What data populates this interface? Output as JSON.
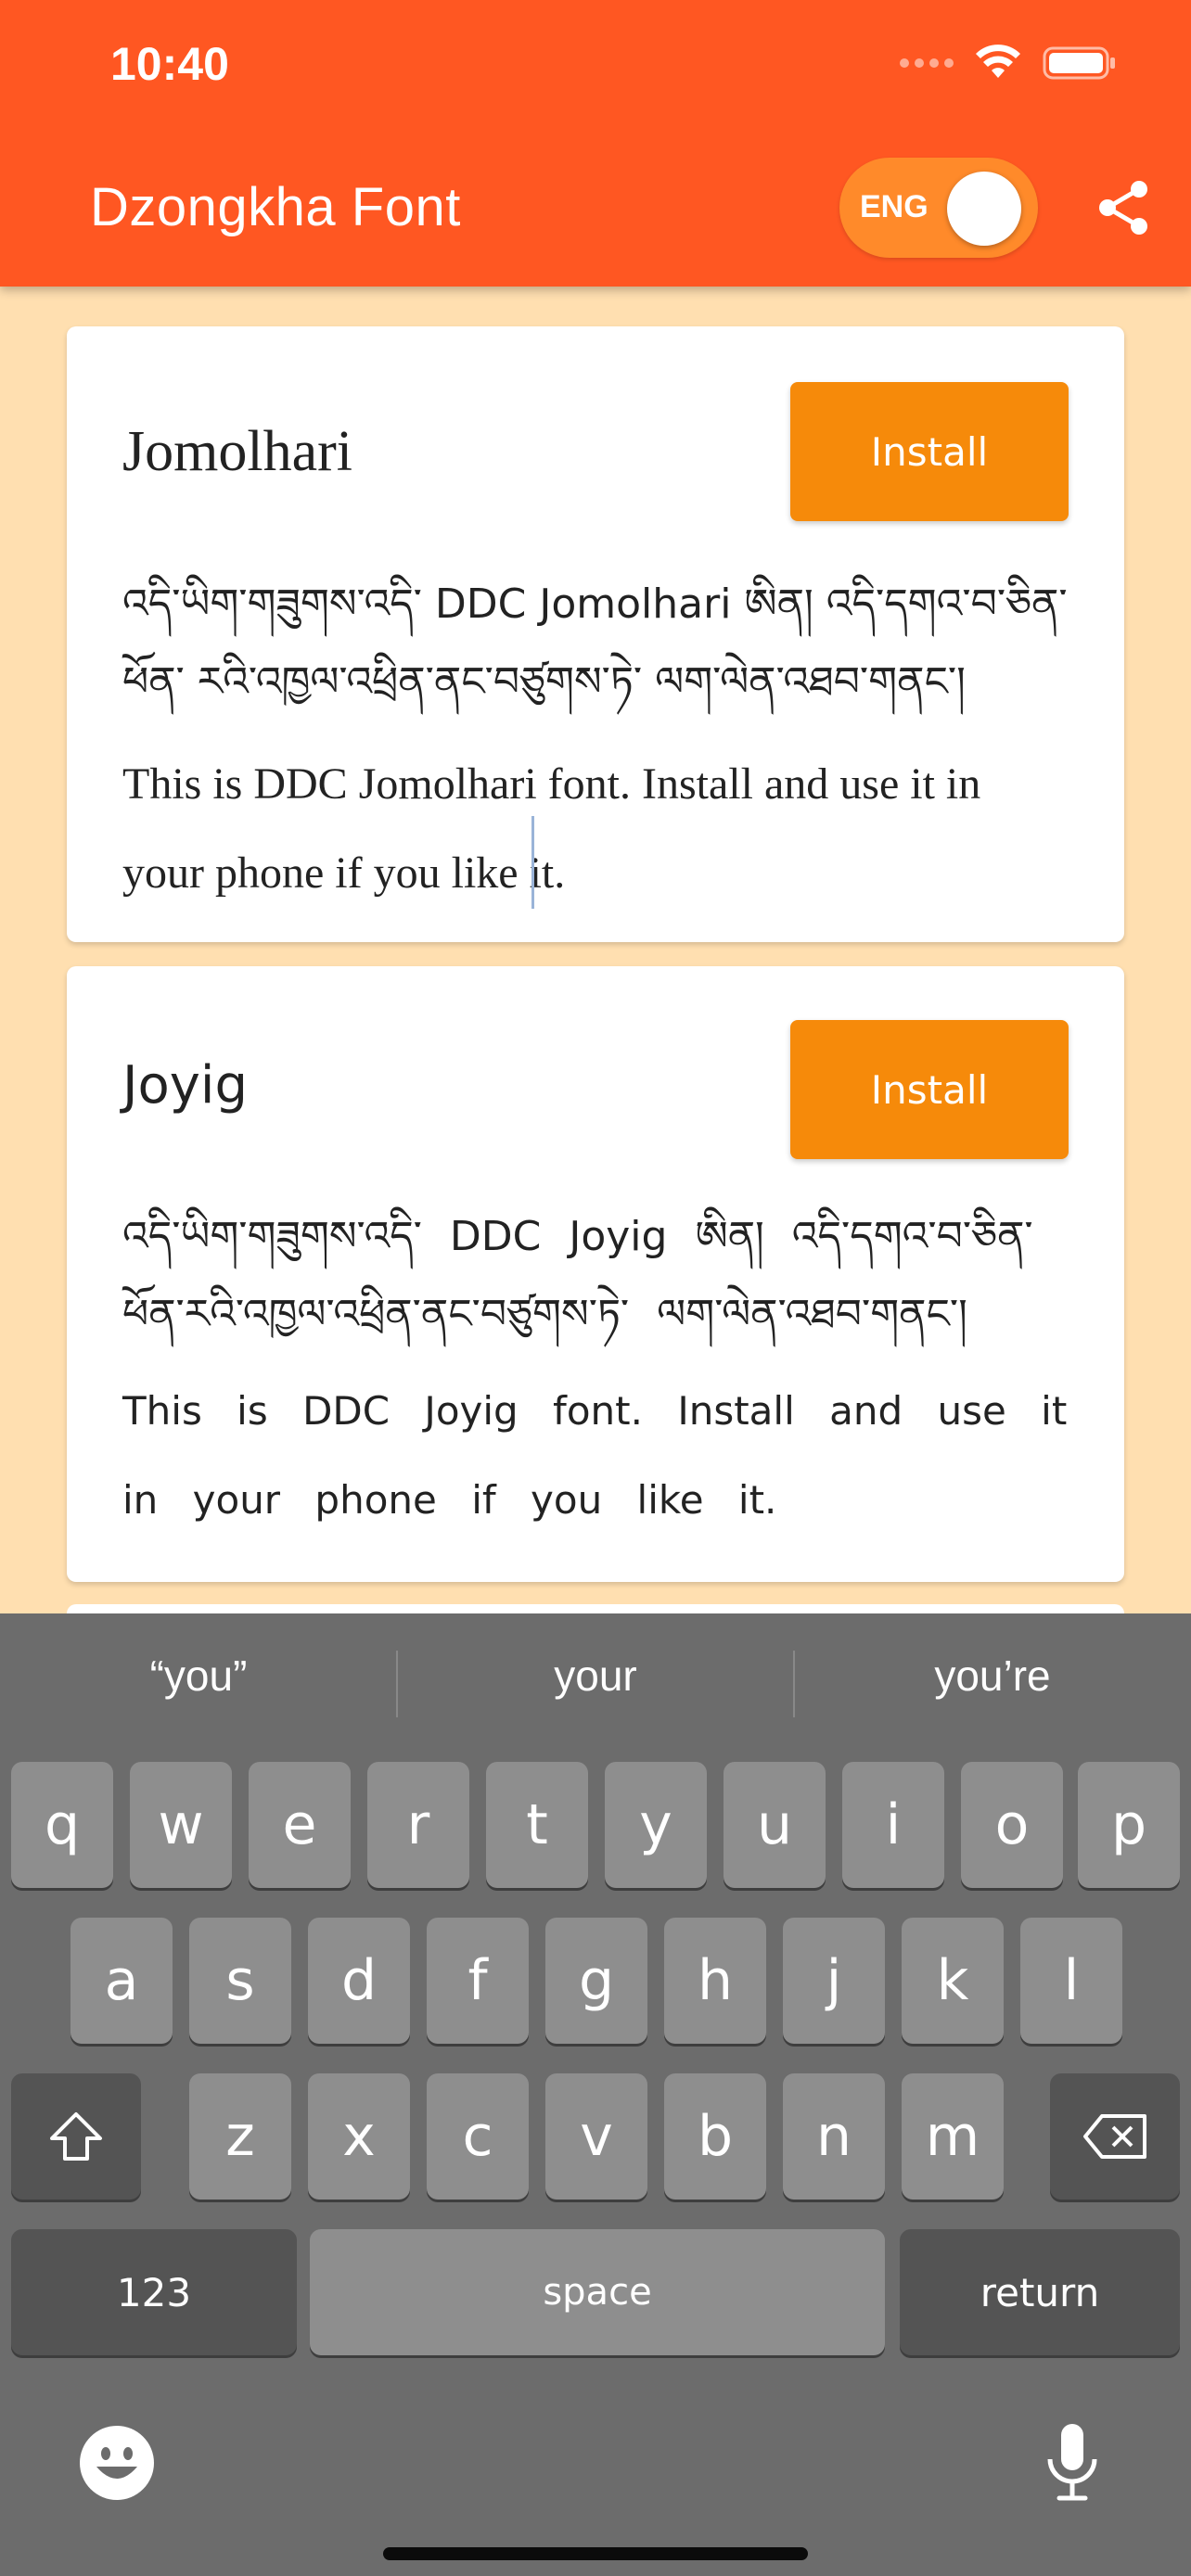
{
  "status_bar": {
    "time": "10:40"
  },
  "app_bar": {
    "title": "Dzongkha Font",
    "lang_label": "ENG"
  },
  "cards": [
    {
      "title": "Jomolhari",
      "install_label": "Install",
      "dz_text": "འདི་ཡིག་གཟུགས་འདི་ DDC Jomolhari ཨིན། འདི་དགའ་བ་ཅིན་ ཕོན་ རའི་འཁྱལ་འཕྲིན་ནང་བཙུགས་ཏེ་ ལག་ལེན་འཐབ་གནང་།",
      "en_text": "This is DDC Jomolhari font. Install and use it in your phone if you like it."
    },
    {
      "title": "Joyig",
      "install_label": "Install",
      "dz_text": "འདི་ཡིག་གཟུགས་འདི་ DDC Joyig ཨིན། འདི་དགའ་བ་ཅིན་ ཕོན་རའི་འཁྱལ་འཕྲིན་ནང་བཙུགས་ཏེ་ ལག་ལེན་འཐབ་གནང་།",
      "en_text": "This is DDC Joyig font. Install and use it in your phone if you like it."
    }
  ],
  "keyboard": {
    "suggestions": [
      "“you”",
      "your",
      "you’re"
    ],
    "row1": [
      "q",
      "w",
      "e",
      "r",
      "t",
      "y",
      "u",
      "i",
      "o",
      "p"
    ],
    "row2": [
      "a",
      "s",
      "d",
      "f",
      "g",
      "h",
      "j",
      "k",
      "l"
    ],
    "row3": [
      "z",
      "x",
      "c",
      "v",
      "b",
      "n",
      "m"
    ],
    "numbers_label": "123",
    "space_label": "space",
    "return_label": "return"
  }
}
